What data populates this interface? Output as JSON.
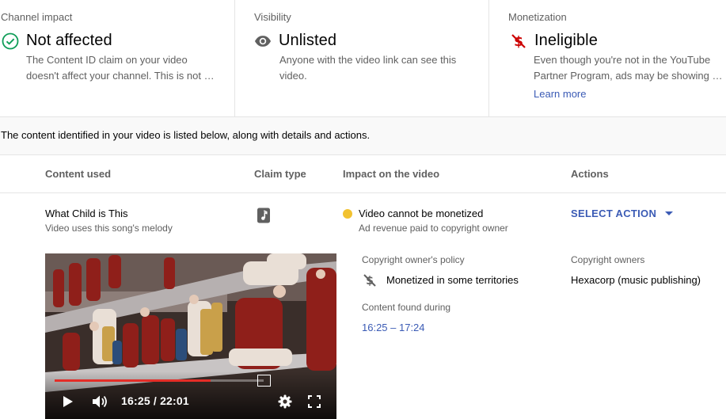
{
  "summary": {
    "channel_impact": {
      "label": "Channel impact",
      "status": "Not affected",
      "icon": "check-circle-icon",
      "description": "The Content ID claim on your video doesn't affect your channel. This is not …",
      "color": "#0f9d58"
    },
    "visibility": {
      "label": "Visibility",
      "status": "Unlisted",
      "icon": "eye-icon",
      "description_line1": "Anyone with the video link can see this",
      "description_line2": "video."
    },
    "monetization": {
      "label": "Monetization",
      "status": "Ineligible",
      "icon": "dollar-off-icon",
      "description_line1": "Even though you're not in the YouTube",
      "description_line2": "Partner Program, ads may be showing o…",
      "learn_more": "Learn more",
      "color": "#cc0000"
    }
  },
  "info_band": "The content identified in your video is listed below, along with details and actions.",
  "table": {
    "headers": {
      "content_used": "Content used",
      "claim_type": "Claim type",
      "impact": "Impact on the video",
      "actions": "Actions"
    },
    "row": {
      "title": "What Child is This",
      "subtitle": "Video uses this song's melody",
      "claim_type_icon": "music-note-icon",
      "impact_title": "Video cannot be monetized",
      "impact_subtitle": "Ad revenue paid to copyright owner",
      "impact_color": "#f2c230",
      "action_label": "SELECT ACTION"
    }
  },
  "player": {
    "time": "16:25 / 22:01",
    "progress_fraction": 0.745
  },
  "details": {
    "policy_label": "Copyright owner's policy",
    "policy_value": "Monetized in some territories",
    "found_label": "Content found during",
    "found_value": "16:25 – 17:24",
    "owners_label": "Copyright owners",
    "owners_value": "Hexacorp (music publishing)"
  }
}
